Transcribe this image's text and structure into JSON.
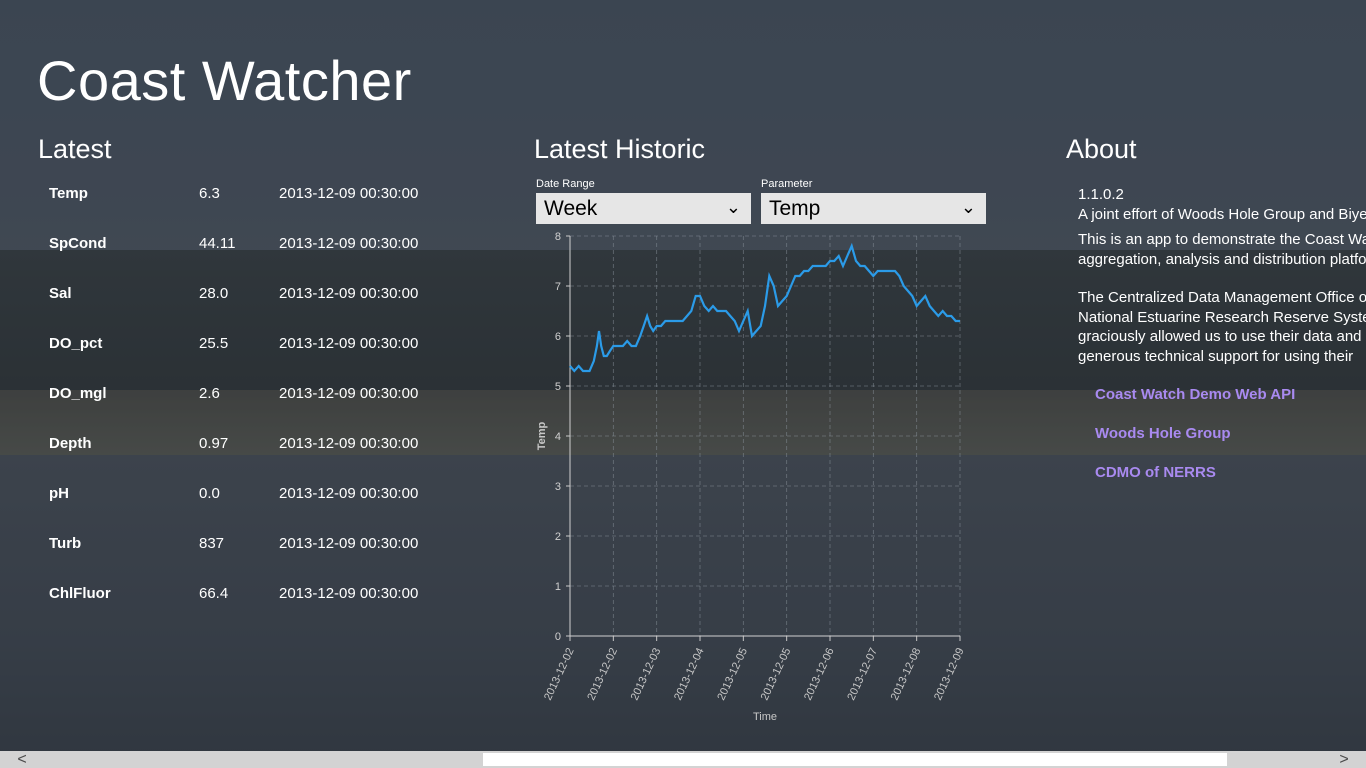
{
  "app_title": "Coast Watcher",
  "latest": {
    "title": "Latest",
    "rows": [
      {
        "param": "Temp",
        "value": "6.3",
        "time": "2013-12-09 00:30:00"
      },
      {
        "param": "SpCond",
        "value": "44.11",
        "time": "2013-12-09 00:30:00"
      },
      {
        "param": "Sal",
        "value": "28.0",
        "time": "2013-12-09 00:30:00"
      },
      {
        "param": "DO_pct",
        "value": "25.5",
        "time": "2013-12-09 00:30:00"
      },
      {
        "param": "DO_mgl",
        "value": "2.6",
        "time": "2013-12-09 00:30:00"
      },
      {
        "param": "Depth",
        "value": "0.97",
        "time": "2013-12-09 00:30:00"
      },
      {
        "param": "pH",
        "value": "0.0",
        "time": "2013-12-09 00:30:00"
      },
      {
        "param": "Turb",
        "value": "837",
        "time": "2013-12-09 00:30:00"
      },
      {
        "param": "ChlFluor",
        "value": "66.4",
        "time": "2013-12-09 00:30:00"
      }
    ]
  },
  "historic": {
    "title": "Latest Historic",
    "date_range_label": "Date Range",
    "date_range_value": "Week",
    "parameter_label": "Parameter",
    "parameter_value": "Temp"
  },
  "chart_data": {
    "type": "line",
    "xlabel": "Time",
    "ylabel": "Temp",
    "ylim": [
      0,
      8
    ],
    "y_ticks": [
      "0",
      "1",
      "2",
      "3",
      "4",
      "5",
      "6",
      "7",
      "8"
    ],
    "x_ticks": [
      "2013-12-02",
      "2013-12-02",
      "2013-12-03",
      "2013-12-04",
      "2013-12-05",
      "2013-12-05",
      "2013-12-06",
      "2013-12-07",
      "2013-12-08",
      "2013-12-09"
    ],
    "grid": true,
    "series": [
      {
        "color": "#2b9be8",
        "x": [
          0,
          0.1,
          0.2,
          0.3,
          0.45,
          0.55,
          0.62,
          0.67,
          0.72,
          0.78,
          0.85,
          0.92,
          1.0,
          1.1,
          1.22,
          1.32,
          1.42,
          1.52,
          1.62,
          1.7,
          1.78,
          1.85,
          1.92,
          2.0,
          2.1,
          2.2,
          2.3,
          2.4,
          2.5,
          2.6,
          2.7,
          2.8,
          2.9,
          3.0,
          3.1,
          3.2,
          3.3,
          3.4,
          3.5,
          3.6,
          3.7,
          3.8,
          3.9,
          4.0,
          4.1,
          4.2,
          4.3,
          4.4,
          4.5,
          4.6,
          4.7,
          4.8,
          4.9,
          5.0,
          5.1,
          5.2,
          5.3,
          5.4,
          5.5,
          5.6,
          5.7,
          5.8,
          5.9,
          6.0,
          6.1,
          6.2,
          6.3,
          6.4,
          6.5,
          6.6,
          6.7,
          6.8,
          6.9,
          7.0,
          7.1,
          7.2,
          7.3,
          7.4,
          7.5,
          7.6,
          7.7,
          7.8,
          7.9,
          8.0,
          8.1,
          8.2,
          8.3,
          8.4,
          8.5,
          8.6,
          8.7,
          8.8,
          8.9,
          9.0
        ],
        "y": [
          5.4,
          5.3,
          5.4,
          5.3,
          5.3,
          5.5,
          5.8,
          6.1,
          5.8,
          5.6,
          5.6,
          5.7,
          5.8,
          5.8,
          5.8,
          5.9,
          5.8,
          5.8,
          6.0,
          6.2,
          6.4,
          6.2,
          6.1,
          6.2,
          6.2,
          6.3,
          6.3,
          6.3,
          6.3,
          6.3,
          6.4,
          6.5,
          6.8,
          6.8,
          6.6,
          6.5,
          6.6,
          6.5,
          6.5,
          6.5,
          6.4,
          6.3,
          6.1,
          6.3,
          6.5,
          6.0,
          6.1,
          6.2,
          6.6,
          7.2,
          7.0,
          6.6,
          6.7,
          6.8,
          7.0,
          7.2,
          7.2,
          7.3,
          7.3,
          7.4,
          7.4,
          7.4,
          7.4,
          7.5,
          7.5,
          7.6,
          7.4,
          7.6,
          7.8,
          7.5,
          7.4,
          7.4,
          7.3,
          7.2,
          7.3,
          7.3,
          7.3,
          7.3,
          7.3,
          7.2,
          7.0,
          6.9,
          6.8,
          6.6,
          6.7,
          6.8,
          6.6,
          6.5,
          6.4,
          6.5,
          6.4,
          6.4,
          6.3,
          6.3
        ]
      }
    ]
  },
  "about": {
    "title": "About",
    "version": "1.1.0.2",
    "credit": "A joint effort of Woods Hole Group and Biyeo",
    "desc1": "This is an app to demonstrate the Coast Watch aggregation, analysis and distribution platform.",
    "desc2": "The Centralized Data Management Office of the National Estuarine Research Reserve System graciously allowed us to use their data and generous technical support for using their",
    "links": [
      "Coast Watch Demo Web API",
      "Woods Hole Group",
      "CDMO of NERRS"
    ]
  },
  "scrollbar": {
    "left_arrow": "<",
    "right_arrow": ">"
  }
}
